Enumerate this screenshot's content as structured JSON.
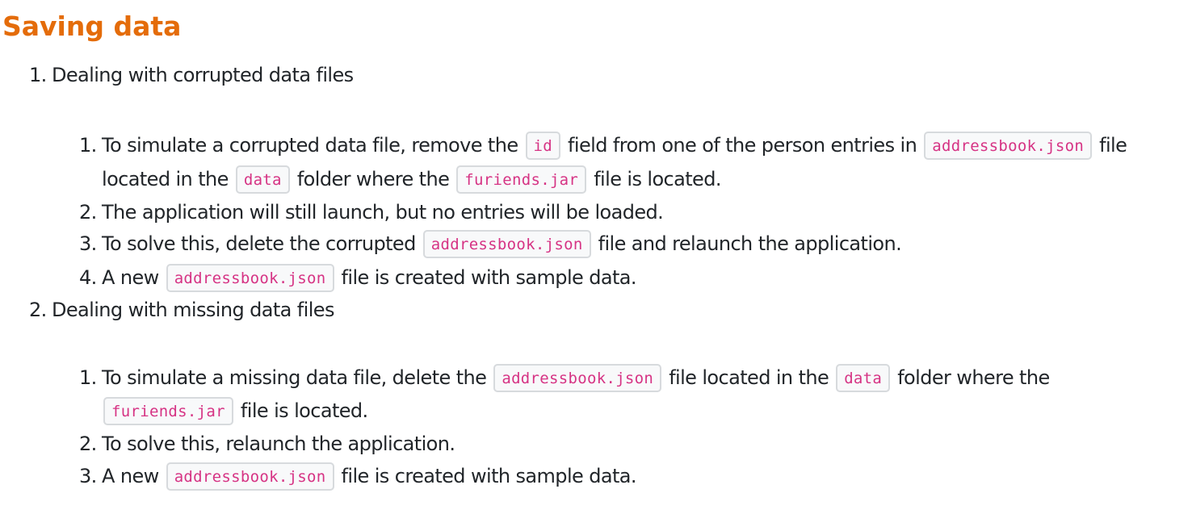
{
  "section": {
    "title": "Saving data"
  },
  "items": [
    {
      "num": "1.",
      "title": "Dealing with corrupted data files",
      "steps": [
        {
          "num": "1.",
          "parts": [
            "To simulate a corrupted data file, remove the",
            "id",
            "field from one of the person entries in",
            "addressbook.json",
            "file",
            "located in the",
            "data",
            "folder where the",
            "furiends.jar",
            "file is located."
          ]
        },
        {
          "num": "2.",
          "parts": [
            "The application will still launch, but no entries will be loaded."
          ]
        },
        {
          "num": "3.",
          "parts": [
            "To solve this, delete the corrupted",
            "addressbook.json",
            "file and relaunch the application."
          ]
        },
        {
          "num": "4.",
          "parts": [
            "A new",
            "addressbook.json",
            "file is created with sample data."
          ]
        }
      ]
    },
    {
      "num": "2.",
      "title": "Dealing with missing data files",
      "steps": [
        {
          "num": "1.",
          "parts": [
            "To simulate a missing data file, delete the",
            "addressbook.json",
            "file located in the",
            "data",
            "folder where the",
            "furiends.jar",
            "file is located."
          ]
        },
        {
          "num": "2.",
          "parts": [
            "To solve this, relaunch the application."
          ]
        },
        {
          "num": "3.",
          "parts": [
            "A new",
            "addressbook.json",
            "file is created with sample data."
          ]
        }
      ]
    }
  ],
  "colors": {
    "heading": "#e46c0a",
    "code_text": "#d63384",
    "code_border": "#d7dadd",
    "body_text": "#212529"
  }
}
